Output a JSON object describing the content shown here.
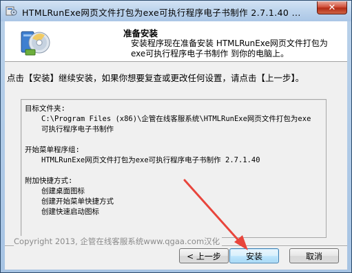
{
  "window": {
    "title": "HTMLRunExe网页文件打包为exe可执行程序电子书制作 2.7.1.40 ...",
    "close_glyph": "✕"
  },
  "header": {
    "title": "准备安装",
    "subtitle": "安装程序现在准备安装 HTMLRunExe网页文件打包为exe可执行程序电子书制作 到你的电脑上。"
  },
  "instruction": "点击【安装】继续安装，如果你想要复查或更改任何设置，请点击【上一步】。",
  "summary": {
    "dest_label": "目标文件夹:",
    "dest_value": "C:\\Program Files (x86)\\企管在线客服系统\\HTMLRunExe网页文件打包为exe可执行程序电子书制作",
    "start_label": "开始菜单程序组:",
    "start_value": "HTMLRunExe网页文件打包为exe可执行程序电子书制作 2.7.1.40",
    "shortcut_label": "附加快捷方式:",
    "shortcuts": [
      "创建桌面图标",
      "创建开始菜单快捷方式",
      "创建快速启动图标"
    ]
  },
  "copyright": "Copyright 2013, 企管在线客服系统www.qgaa.com汉化",
  "buttons": {
    "back": "< 上一步",
    "install": "安装",
    "cancel": "取消"
  },
  "colors": {
    "annotation_arrow": "#e8453c",
    "close_button": "#c9412a"
  }
}
